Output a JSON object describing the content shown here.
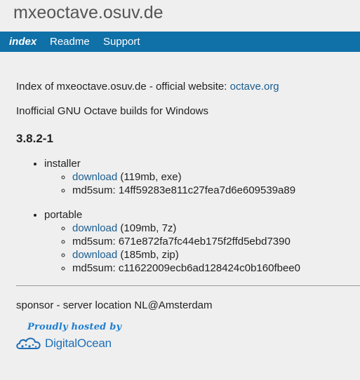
{
  "header": {
    "site_title": "mxeoctave.osuv.de"
  },
  "nav": {
    "items": [
      {
        "label": "index",
        "active": true
      },
      {
        "label": "Readme",
        "active": false
      },
      {
        "label": "Support",
        "active": false
      }
    ]
  },
  "main": {
    "index_text": "Index of mxeoctave.osuv.de - official website: ",
    "index_link": "octave.org",
    "description": "Inofficial GNU Octave builds for Windows",
    "version": "3.8.2-1",
    "installer": {
      "label": "installer",
      "items": [
        {
          "link": "download",
          "text": " (119mb, exe)"
        },
        {
          "text": "md5sum: 14ff59283e811c27fea7d6e609539a89"
        }
      ]
    },
    "portable": {
      "label": "portable",
      "items": [
        {
          "link": "download",
          "text": " (109mb, 7z)"
        },
        {
          "text": "md5sum: 671e872fa7fc44eb175f2ffd5ebd7390"
        },
        {
          "link": "download",
          "text": " (185mb, zip)"
        },
        {
          "text": "md5sum: c11622009ecb6ad128424c0b160fbee0"
        }
      ]
    }
  },
  "footer": {
    "sponsor": "sponsor - server location NL@Amsterdam",
    "badge_top": "Proudly hosted by",
    "badge_name": "DigitalOcean"
  },
  "colors": {
    "navbar": "#1070a8",
    "link": "#1a5d8f",
    "background": "#efefef",
    "brand": "#1e6fb8"
  }
}
